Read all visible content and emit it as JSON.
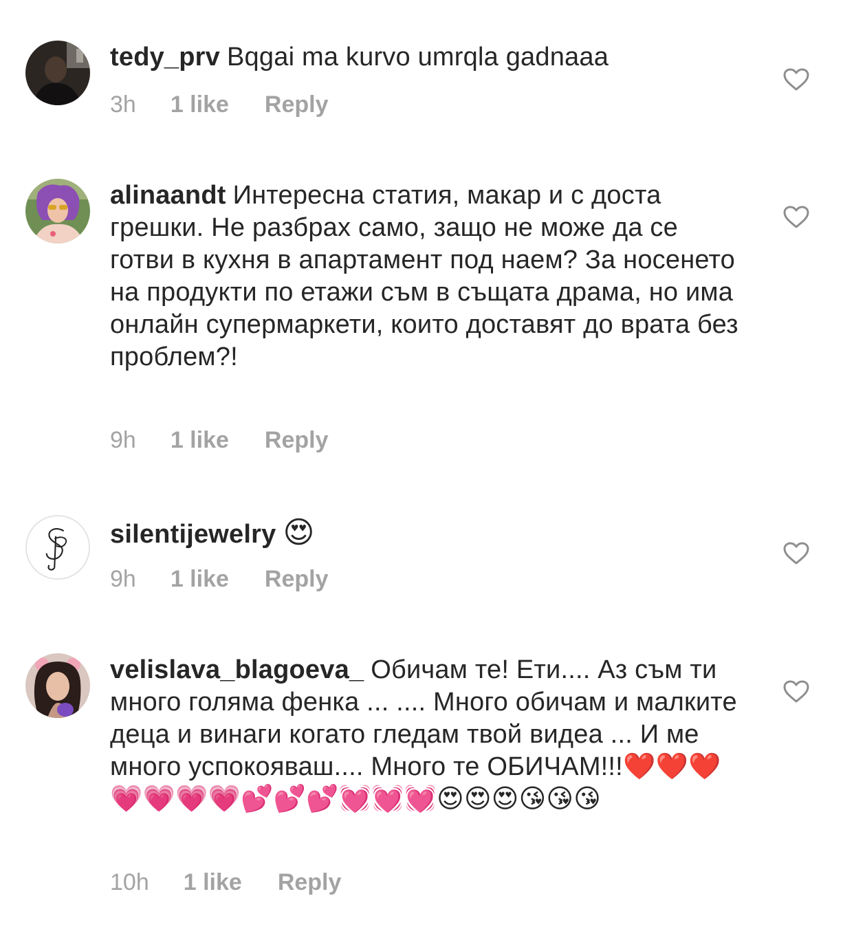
{
  "comments": [
    {
      "username": "tedy_prv",
      "text": "Bqgai ma kurvo umrqla gadnaaa",
      "time": "3h",
      "likes": "1 like",
      "reply": "Reply",
      "avatar_icon": "profile-photo"
    },
    {
      "username": "alinaandt",
      "text": "Интересна статия, макар и с доста грешки. Не разбрах само, защо не може да се готви в кухня в апартамент под наем? За носенето на продукти по етажи съм в същата драма, но има онлайн супермаркети, които доставят до врата без проблем?!",
      "time": "9h",
      "likes": "1 like",
      "reply": "Reply",
      "avatar_icon": "profile-photo"
    },
    {
      "username": "silentijewelry",
      "text": "😍",
      "time": "9h",
      "likes": "1 like",
      "reply": "Reply",
      "avatar_icon": "brand-logo"
    },
    {
      "username": "velislava_blagoeva_",
      "text": "Обичам те! Ети.... Аз съм ти много голяма фенка ... .... Много обичам и малките деца и винаги когато гледам твой видеа ... И ме много успокояваш.... Много те ОБИЧАМ!!!❤️❤️❤️💗💗💗💗💕💕💕💓💓💓😍😍😍😘😘😘",
      "time": "10h",
      "likes": "1 like",
      "reply": "Reply",
      "avatar_icon": "profile-photo"
    }
  ],
  "colors": {
    "text": "#262626",
    "meta": "#a3a3a3",
    "heart_outline": "#8e8e8e"
  }
}
